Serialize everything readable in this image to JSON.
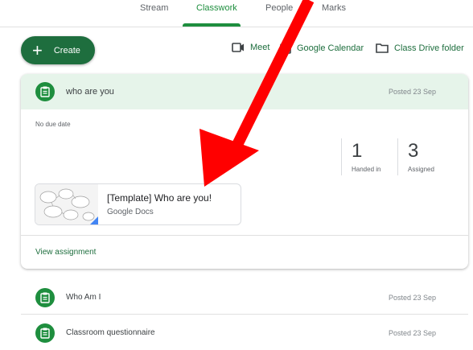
{
  "tabs": [
    {
      "label": "Stream"
    },
    {
      "label": "Classwork"
    },
    {
      "label": "People"
    },
    {
      "label": "Marks"
    }
  ],
  "toolbar": {
    "create_label": "Create",
    "meet_label": "Meet",
    "calendar_label": "Google Calendar",
    "drive_label": "Class Drive folder"
  },
  "assignment": {
    "title": "who are you",
    "posted": "Posted 23 Sep",
    "due": "No due date",
    "handed_in": "1",
    "handed_in_label": "Handed in",
    "assigned": "3",
    "assigned_label": "Assigned",
    "attachment_title": "[Template] Who are you!",
    "attachment_type": "Google Docs",
    "view_label": "View assignment"
  },
  "list": [
    {
      "title": "Who Am I",
      "posted": "Posted 23 Sep"
    },
    {
      "title": "Classroom questionnaire",
      "posted": "Posted 23 Sep"
    }
  ],
  "colors": {
    "accent": "#1e8e3e",
    "header_bg": "#e6f4ea",
    "annotation_arrow": "#ff0000"
  },
  "icons": [
    "assignment-icon",
    "video-camera-icon",
    "calendar-icon",
    "folder-icon",
    "plus-icon"
  ]
}
